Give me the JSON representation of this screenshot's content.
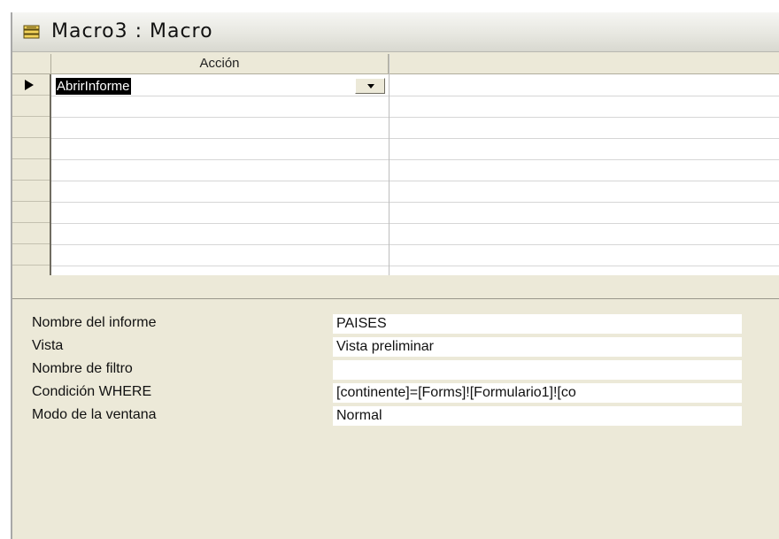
{
  "window": {
    "title": "Macro3 : Macro",
    "icon": "macro-icon"
  },
  "grid": {
    "column_header": "Acción",
    "rows": [
      {
        "action": "AbrirInforme",
        "current": true
      }
    ],
    "dropdown_icon": "chevron-down-icon"
  },
  "arguments": [
    {
      "label": "Nombre del informe",
      "value": "PAISES"
    },
    {
      "label": "Vista",
      "value": "Vista preliminar"
    },
    {
      "label": "Nombre de filtro",
      "value": ""
    },
    {
      "label": "Condición WHERE",
      "value": "[continente]=[Forms]![Formulario1]![co"
    },
    {
      "label": "Modo de la ventana",
      "value": "Normal"
    }
  ]
}
